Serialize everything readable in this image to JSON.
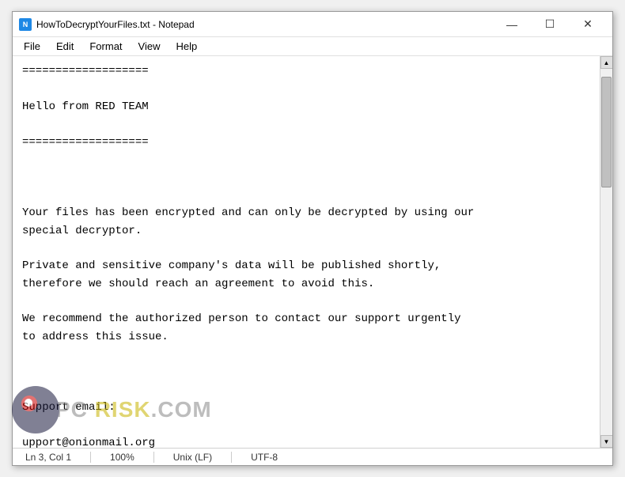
{
  "window": {
    "title": "HowToDecryptYourFiles.txt - Notepad",
    "icon_label": "N"
  },
  "titlebar": {
    "minimize_label": "—",
    "maximize_label": "☐",
    "close_label": "✕"
  },
  "menu": {
    "items": [
      "File",
      "Edit",
      "Format",
      "View",
      "Help"
    ]
  },
  "editor": {
    "content": "===================\n\nHello from RED TEAM\n\n===================\n\n\n\nYour files has been encrypted and can only be decrypted by using our\nspecial decryptor.\n\nPrivate and sensitive company's data will be published shortly,\ntherefore we should reach an agreement to avoid this.\n\nWe recommend the authorized person to contact our support urgently\nto address this issue.\n\n\n\nSupport email:\n\nupport@onionmail.org"
  },
  "statusbar": {
    "position": "Ln 3, Col 1",
    "zoom": "100%",
    "line_ending": "Unix (LF)",
    "encoding": "UTF-8"
  },
  "watermark": {
    "site": "PC RISK.COM"
  }
}
